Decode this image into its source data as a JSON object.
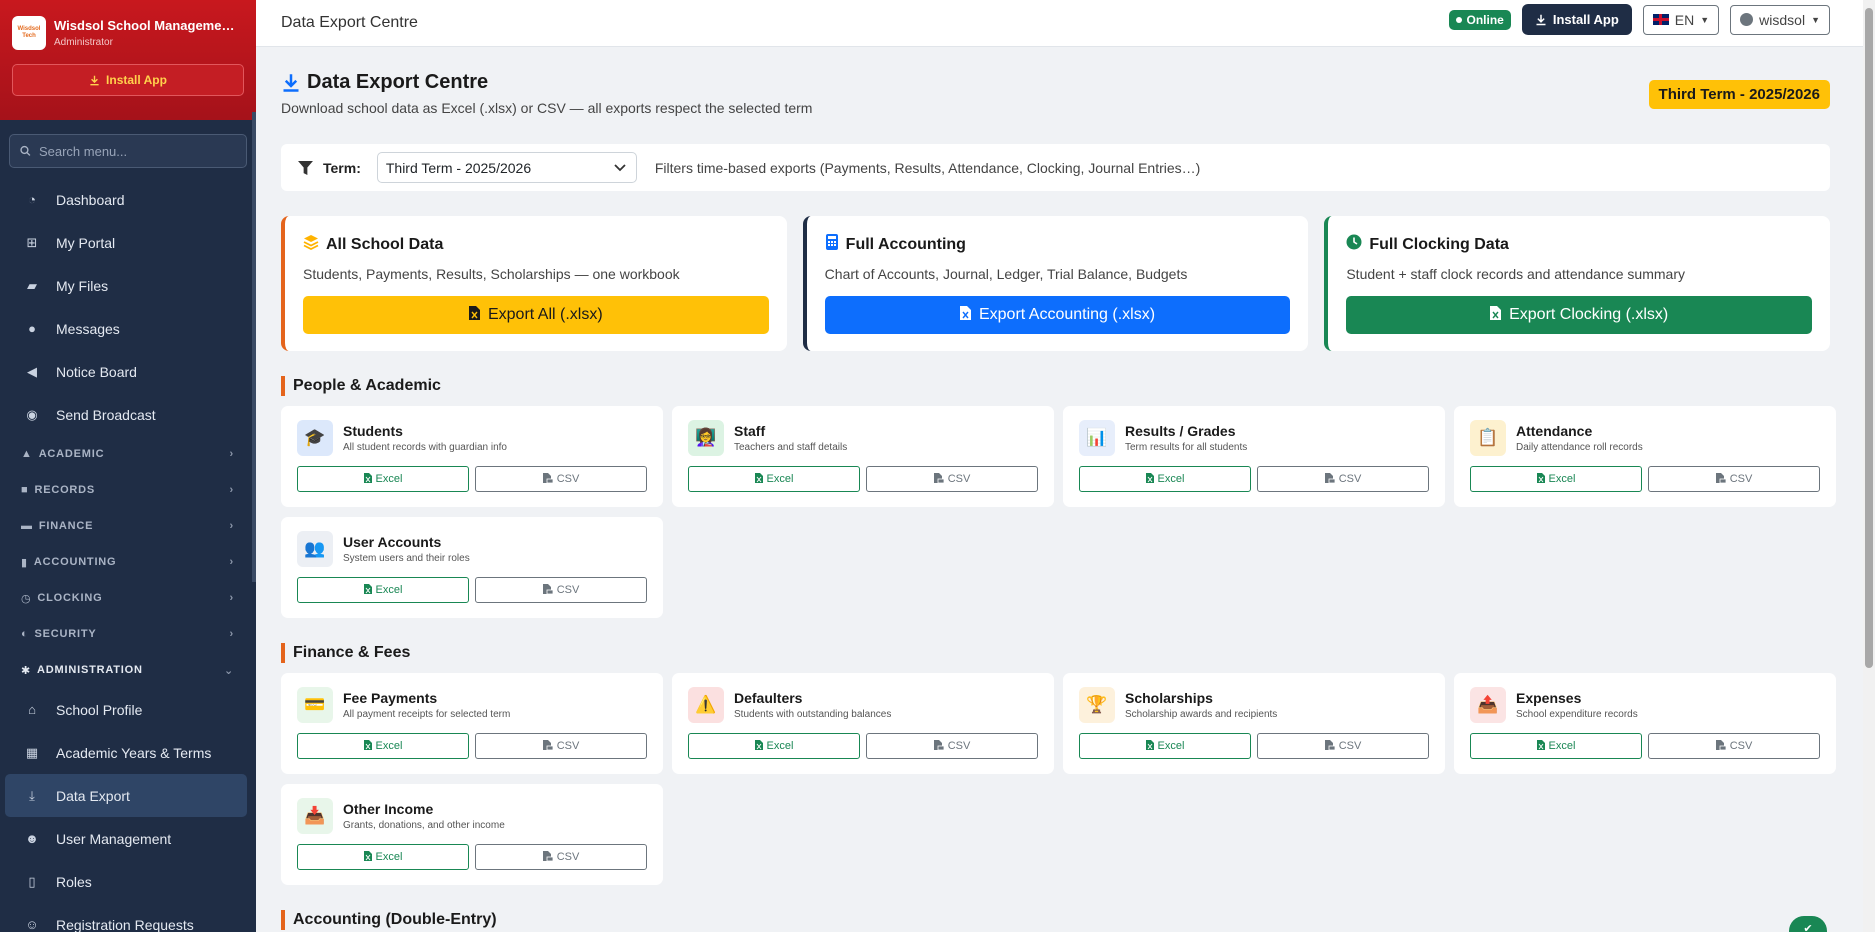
{
  "sidebar": {
    "brand_name": "Wisdsol School Manageme…",
    "brand_role": "Administrator",
    "logo_text": "Wisdsol Tech",
    "install_label": "Install App",
    "search_placeholder": "Search menu...",
    "items_top": [
      {
        "label": "Dashboard",
        "icon": "dashboard-icon"
      },
      {
        "label": "My Portal",
        "icon": "portal-icon"
      },
      {
        "label": "My Files",
        "icon": "folder-icon"
      },
      {
        "label": "Messages",
        "icon": "chat-icon"
      },
      {
        "label": "Notice Board",
        "icon": "megaphone-icon"
      },
      {
        "label": "Send Broadcast",
        "icon": "broadcast-icon"
      }
    ],
    "groups": [
      {
        "label": "ACADEMIC"
      },
      {
        "label": "RECORDS"
      },
      {
        "label": "FINANCE"
      },
      {
        "label": "ACCOUNTING"
      },
      {
        "label": "CLOCKING"
      },
      {
        "label": "SECURITY"
      },
      {
        "label": "ADMINISTRATION"
      }
    ],
    "items_admin": [
      {
        "label": "School Profile",
        "icon": "school-icon"
      },
      {
        "label": "Academic Years & Terms",
        "icon": "calendar-icon"
      },
      {
        "label": "Data Export",
        "icon": "download-icon",
        "active": true
      },
      {
        "label": "User Management",
        "icon": "users-icon"
      },
      {
        "label": "Roles",
        "icon": "id-badge-icon"
      },
      {
        "label": "Registration Requests",
        "icon": "user-plus-icon"
      }
    ]
  },
  "topbar": {
    "title": "Data Export Centre",
    "status": "Online",
    "install_label": "Install App",
    "language": "EN",
    "user": "wisdsol"
  },
  "page": {
    "title": "Data Export Centre",
    "subtitle": "Download school data as Excel (.xlsx) or CSV — all exports respect the selected term",
    "term_badge": "Third Term - 2025/2026"
  },
  "filter": {
    "label": "Term:",
    "selected": "Third Term - 2025/2026",
    "note": "Filters time-based exports (Payments, Results, Attendance, Clocking, Journal Entries…)"
  },
  "big_cards": [
    {
      "title": "All School Data",
      "desc": "Students, Payments, Results, Scholarships — one workbook",
      "button": "Export All (.xlsx)",
      "color": "#ffc107",
      "border": "#e4641c",
      "text_color": "#1a1a1a",
      "icon": "layers-icon",
      "icon_color": "#ffb300"
    },
    {
      "title": "Full Accounting",
      "desc": "Chart of Accounts, Journal, Ledger, Trial Balance, Budgets",
      "button": "Export Accounting (.xlsx)",
      "color": "#0d6efd",
      "border": "#1f2d45",
      "text_color": "#ffffff",
      "icon": "calculator-icon",
      "icon_color": "#0d6efd"
    },
    {
      "title": "Full Clocking Data",
      "desc": "Student + staff clock records and attendance summary",
      "button": "Export Clocking (.xlsx)",
      "color": "#198754",
      "border": "#198754",
      "text_color": "#ffffff",
      "icon": "clock-icon",
      "icon_color": "#198754"
    }
  ],
  "buttons": {
    "excel": "Excel",
    "csv": "CSV"
  },
  "sections": [
    {
      "title": "People & Academic",
      "cards": [
        {
          "name": "Students",
          "desc": "All student records with guardian info",
          "icon": "🎓",
          "icon_name": "graduation-cap-icon",
          "bg": "#dce8fb"
        },
        {
          "name": "Staff",
          "desc": "Teachers and staff details",
          "icon": "👩‍🏫",
          "icon_name": "teacher-icon",
          "bg": "#dcf3e3"
        },
        {
          "name": "Results / Grades",
          "desc": "Term results for all students",
          "icon": "📊",
          "icon_name": "bar-chart-icon",
          "bg": "#e7eefb"
        },
        {
          "name": "Attendance",
          "desc": "Daily attendance roll records",
          "icon": "📋",
          "icon_name": "clipboard-icon",
          "bg": "#fdf1cf"
        },
        {
          "name": "User Accounts",
          "desc": "System users and their roles",
          "icon": "👥",
          "icon_name": "users-icon",
          "bg": "#eceff4"
        }
      ]
    },
    {
      "title": "Finance & Fees",
      "cards": [
        {
          "name": "Fee Payments",
          "desc": "All payment receipts for selected term",
          "icon": "💳",
          "icon_name": "credit-card-icon",
          "bg": "#e8f6ea"
        },
        {
          "name": "Defaulters",
          "desc": "Students with outstanding balances",
          "icon": "⚠️",
          "icon_name": "warning-icon",
          "bg": "#fbe0e0"
        },
        {
          "name": "Scholarships",
          "desc": "Scholarship awards and recipients",
          "icon": "🏆",
          "icon_name": "trophy-icon",
          "bg": "#fdf1dc"
        },
        {
          "name": "Expenses",
          "desc": "School expenditure records",
          "icon": "📤",
          "icon_name": "outbox-icon",
          "bg": "#fbe4e4"
        },
        {
          "name": "Other Income",
          "desc": "Grants, donations, and other income",
          "icon": "📥",
          "icon_name": "inbox-icon",
          "bg": "#e8f6ea"
        }
      ]
    },
    {
      "title": "Accounting (Double-Entry)",
      "cards": []
    }
  ]
}
